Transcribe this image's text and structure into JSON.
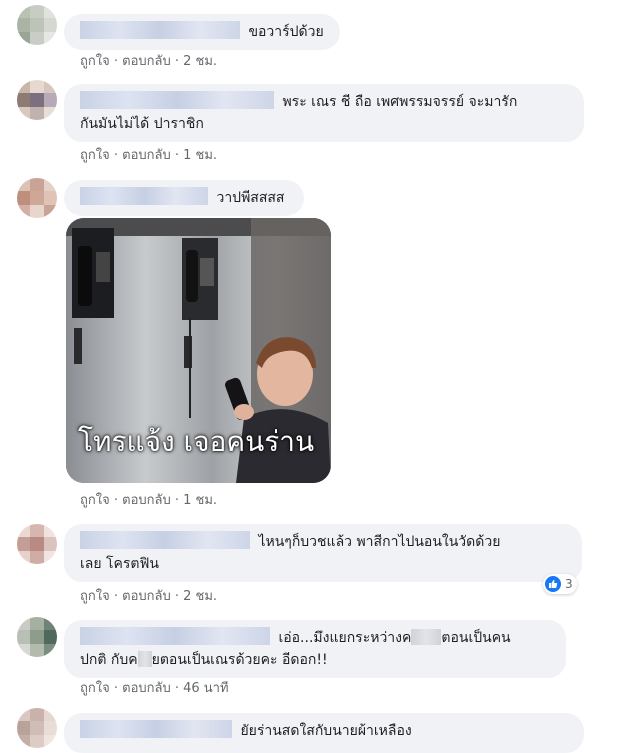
{
  "comments": [
    {
      "text": "ขอวาร์ปด้วย",
      "like": "ถูกใจ",
      "reply": "ตอบกลับ",
      "time": "2 ชม."
    },
    {
      "text_line1": "พระ เณร ชี ถือ เพศพรรมจรรย์ จะมารัก",
      "text_line2": "กันมันไม่ได้ ปาราชิก",
      "like": "ถูกใจ",
      "reply": "ตอบกลับ",
      "time": "1 ชม."
    },
    {
      "text": "วาปพีสสสส",
      "sticker_caption": "โทรแจ้ง เจอคนร่าน",
      "like": "ถูกใจ",
      "reply": "ตอบกลับ",
      "time": "1 ชม."
    },
    {
      "text_line1": "ไหนๆก็บวชแล้ว พาสีกาไปนอนในวัดด้วย",
      "text_line2": "เลย โครตฟิน",
      "like": "ถูกใจ",
      "reply": "ตอบกลับ",
      "time": "2 ชม.",
      "reaction_count": "3"
    },
    {
      "text_line1_a": "เอ่อ...มึงแยกระหว่างค",
      "text_line1_b": "ตอนเป็นคน",
      "text_line2_a": "ปกติ กับค",
      "text_line2_b": "ยตอนเป็นเณรด้วยคะ อีดอก!!",
      "like": "ถูกใจ",
      "reply": "ตอบกลับ",
      "time": "46 นาที"
    },
    {
      "text": "ยัยร่านสดใสกับนายผ้าเหลือง"
    }
  ],
  "separator": "·",
  "colors": {
    "bubble": "#f0f2f5",
    "meta": "#65676b",
    "like_blue": "#1877f2"
  }
}
